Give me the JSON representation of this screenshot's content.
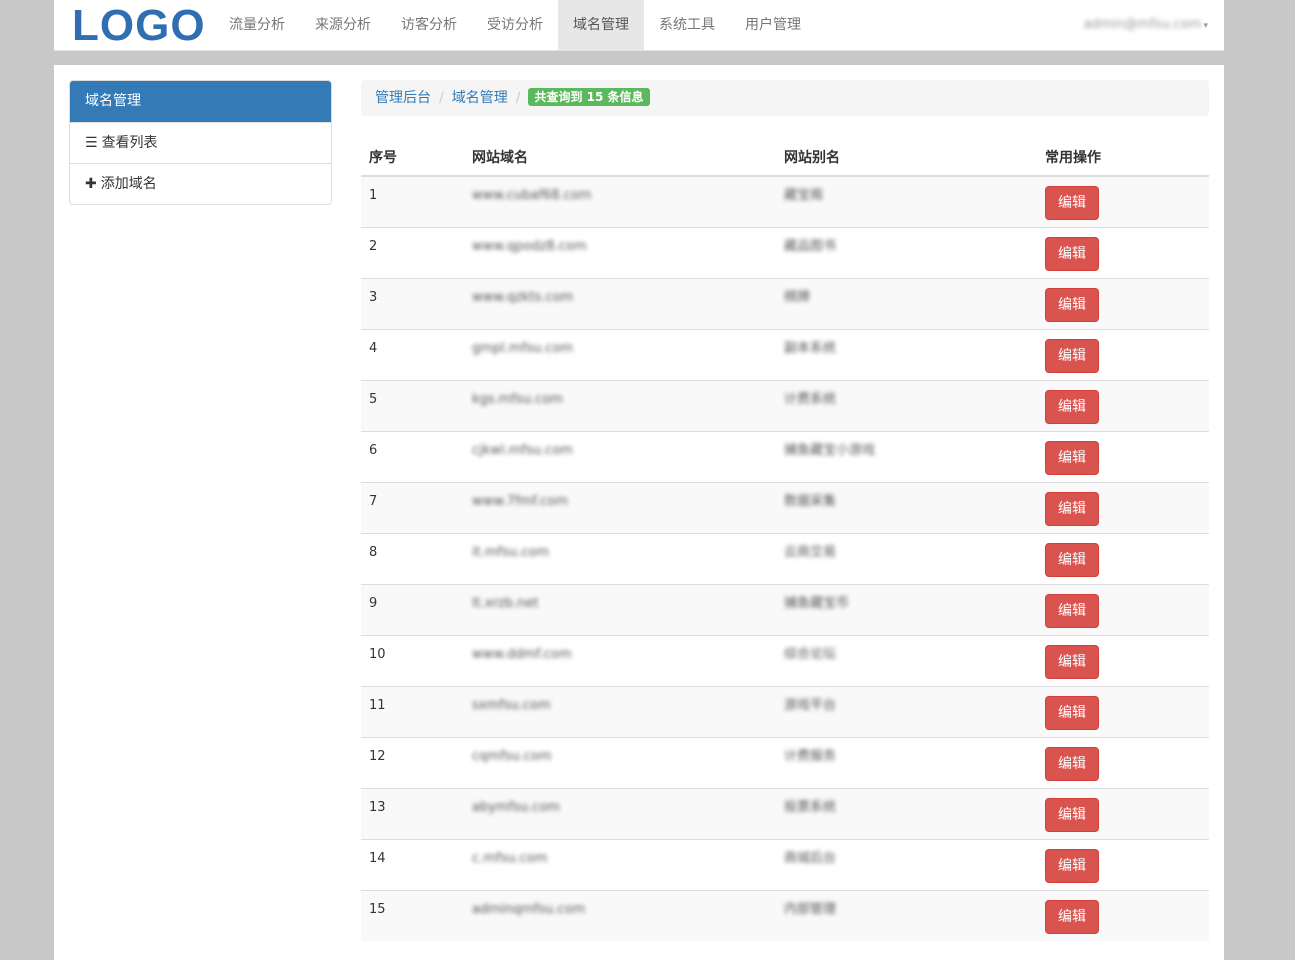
{
  "navbar": {
    "logo": "LOGO",
    "items": [
      "流量分析",
      "来源分析",
      "访客分析",
      "受访分析",
      "域名管理",
      "系统工具",
      "用户管理"
    ],
    "active_index": 4,
    "user": "admin@mfsu.com",
    "user_caret": "▾"
  },
  "sidebar": {
    "title": "域名管理",
    "items": [
      {
        "icon": "list-icon",
        "glyph": "☰",
        "label": "查看列表"
      },
      {
        "icon": "plus-icon",
        "glyph": "✚",
        "label": "添加域名"
      }
    ]
  },
  "breadcrumb": {
    "home": "管理后台",
    "section": "域名管理",
    "separator": "/",
    "badge": "共查询到 15 条信息"
  },
  "table": {
    "headers": [
      "序号",
      "网站域名",
      "网站别名",
      "常用操作"
    ],
    "edit_label": "编辑",
    "rows": [
      {
        "id": "1",
        "domain": "www.cubaf68.com",
        "alias": "藏宝阁"
      },
      {
        "id": "2",
        "domain": "www.qpodz8.com",
        "alias": "藏品图书"
      },
      {
        "id": "3",
        "domain": "www.qzkts.com",
        "alias": "棋牌"
      },
      {
        "id": "4",
        "domain": "gmpl.mfsu.com",
        "alias": "副本系统"
      },
      {
        "id": "5",
        "domain": "kgs.mfsu.com",
        "alias": "计费系统"
      },
      {
        "id": "6",
        "domain": "cjkwl.mfsu.com",
        "alias": "捕鱼藏宝小游戏"
      },
      {
        "id": "7",
        "domain": "www.7fmf.com",
        "alias": "数据采集"
      },
      {
        "id": "8",
        "domain": "it.mfsu.com",
        "alias": "云商交易"
      },
      {
        "id": "9",
        "domain": "lt.xrzb.net",
        "alias": "捕鱼藏宝币"
      },
      {
        "id": "10",
        "domain": "www.ddmf.com",
        "alias": "综合论坛"
      },
      {
        "id": "11",
        "domain": "sxmfsu.com",
        "alias": "游戏平台"
      },
      {
        "id": "12",
        "domain": "cqmfsu.com",
        "alias": "计费服务"
      },
      {
        "id": "13",
        "domain": "abymfsu.com",
        "alias": "投票系统"
      },
      {
        "id": "14",
        "domain": "c.mfsu.com",
        "alias": "商城后台"
      },
      {
        "id": "15",
        "domain": "adminqmfsu.com",
        "alias": "内部管理"
      }
    ]
  },
  "colors": {
    "brand": "#2f6fb1",
    "sidebar_active": "#337ab7",
    "badge": "#5cb85c",
    "danger": "#d9534f"
  }
}
